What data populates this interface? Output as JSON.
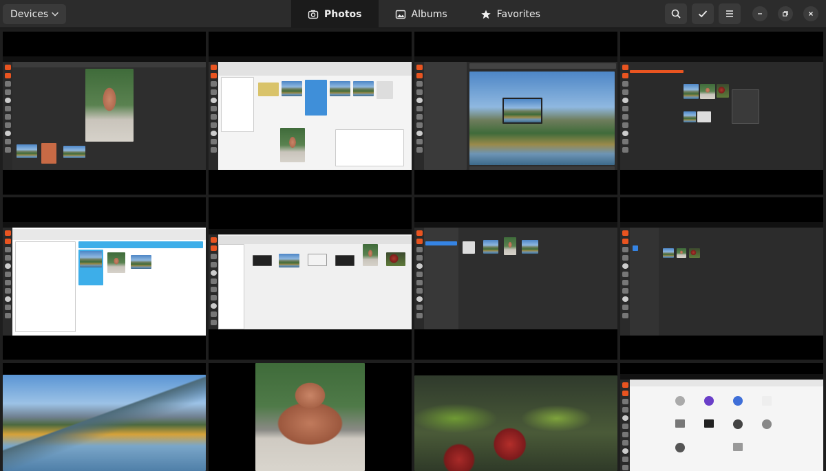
{
  "header": {
    "devices_label": "Devices",
    "tabs": [
      {
        "label": "Photos",
        "icon": "camera-icon",
        "active": true
      },
      {
        "label": "Albums",
        "icon": "albums-icon",
        "active": false
      },
      {
        "label": "Favorites",
        "icon": "star-icon",
        "active": false
      }
    ],
    "actions": [
      "search-icon",
      "check-icon",
      "menu-icon"
    ],
    "window_controls": [
      "minimize-icon",
      "restore-icon",
      "close-icon"
    ]
  },
  "grid": {
    "thumbnails": [
      {
        "kind": "screenshot",
        "subject": "image viewer with buddha photo"
      },
      {
        "kind": "screenshot",
        "subject": "file manager with thumbnails"
      },
      {
        "kind": "screenshot",
        "subject": "image viewer with mountain lake"
      },
      {
        "kind": "screenshot",
        "subject": "dark photo app with context menu"
      },
      {
        "kind": "screenshot",
        "subject": "light photo browser"
      },
      {
        "kind": "screenshot",
        "subject": "file dialog with images"
      },
      {
        "kind": "screenshot",
        "subject": "dark photo library"
      },
      {
        "kind": "screenshot",
        "subject": "dark file manager"
      },
      {
        "kind": "photo",
        "subject": "mountain lake landscape"
      },
      {
        "kind": "photo",
        "subject": "buddha statue"
      },
      {
        "kind": "photo",
        "subject": "red apples on branch"
      },
      {
        "kind": "screenshot",
        "subject": "application grid"
      }
    ]
  },
  "colors": {
    "accent": "#e95420",
    "background": "#1e1e1e",
    "header": "#2c2c2c"
  }
}
